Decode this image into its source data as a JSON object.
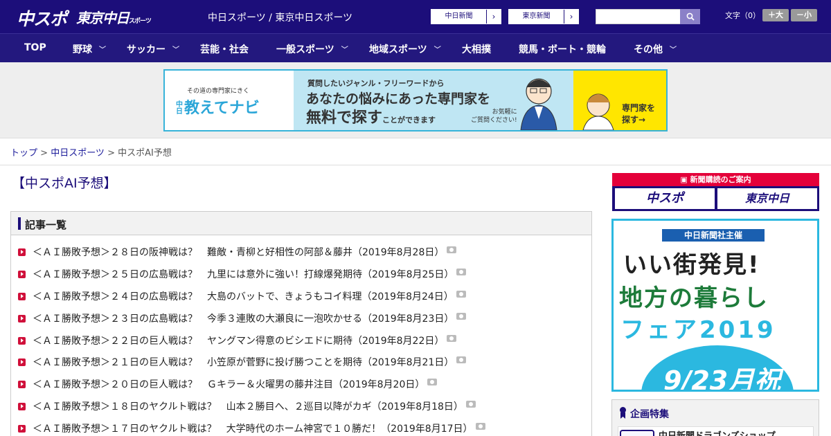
{
  "header": {
    "logo_chuspo": "中スポ",
    "logo_tokyo": "東京中日",
    "logo_tokyo_small": "スポーツ",
    "site_title": "中日スポーツ / 東京中日スポーツ",
    "ext_links": [
      "中日新聞",
      "東京新聞"
    ],
    "search_placeholder": "",
    "font_size_label": "文字（0）",
    "font_plus": "＋大",
    "font_minus": "－小"
  },
  "nav": {
    "items": [
      {
        "label": "TOP",
        "has_dropdown": false
      },
      {
        "label": "野球",
        "has_dropdown": true
      },
      {
        "label": "サッカー",
        "has_dropdown": true
      },
      {
        "label": "芸能・社会",
        "has_dropdown": false
      },
      {
        "label": "一般スポーツ",
        "has_dropdown": true
      },
      {
        "label": "地域スポーツ",
        "has_dropdown": true
      },
      {
        "label": "大相撲",
        "has_dropdown": false
      },
      {
        "label": "競馬・ボート・競輪",
        "has_dropdown": false
      },
      {
        "label": "その他",
        "has_dropdown": true
      }
    ]
  },
  "ad_banner": {
    "sub": "その道の専門家にきく",
    "brand_prefix": "中日",
    "brand": "教えてナビ",
    "line1": "質問したいジャンル・フリーワードから",
    "line2": "あなたの悩みにあった専門家を",
    "line3_main": "無料で探す",
    "line3_small": "ことができます",
    "note1": "お気軽に",
    "note2": "ご質問ください!",
    "cta1": "専門家を",
    "cta2": "探す→"
  },
  "breadcrumb": {
    "home": "トップ",
    "section": "中日スポーツ",
    "current": "中スポAI予想",
    "sep": " > "
  },
  "page_title": "【中スポAI予想】",
  "article_list": {
    "heading": "記事一覧",
    "items": [
      "＜ＡＩ勝敗予想＞２８日の阪神戦は？　難敵・青柳と好相性の阿部＆藤井（2019年8月28日）",
      "＜ＡＩ勝敗予想＞２５日の広島戦は？　九里には意外に強い！打線爆発期待（2019年8月25日）",
      "＜ＡＩ勝敗予想＞２４日の広島戦は？　大島のバットで、きょうもコイ料理（2019年8月24日）",
      "＜ＡＩ勝敗予想＞２３日の広島戦は？　今季３連敗の大瀬良に一泡吹かせる（2019年8月23日）",
      "＜ＡＩ勝敗予想＞２２日の巨人戦は？　ヤングマン得意のビシエドに期待（2019年8月22日）",
      "＜ＡＩ勝敗予想＞２１日の巨人戦は？　小笠原が菅野に投げ勝つことを期待（2019年8月21日）",
      "＜ＡＩ勝敗予想＞２０日の巨人戦は？　Ｇキラー＆火曜男の藤井注目（2019年8月20日）",
      "＜ＡＩ勝敗予想＞１８日のヤクルト戦は？　山本２勝目へ、２巡目以降がカギ（2019年8月18日）",
      "＜ＡＩ勝敗予想＞１７日のヤクルト戦は？　大学時代のホーム神宮で１０勝だ！（2019年8月17日）"
    ]
  },
  "sidebar": {
    "subscribe_head": "新聞購読のご案内",
    "subscribe_chuspo": "中スポ",
    "subscribe_tokyo": "東京中日",
    "fair_tag": "中日新聞社主催",
    "fair_line1": "いい街発見!",
    "fair_line2": "地方の暮らし",
    "fair_line3": "フェア2019",
    "fair_date": "9/23月祝",
    "kikaku_title": "企画特集",
    "kikaku_item": "中日新聞ドラゴンズショップ"
  }
}
